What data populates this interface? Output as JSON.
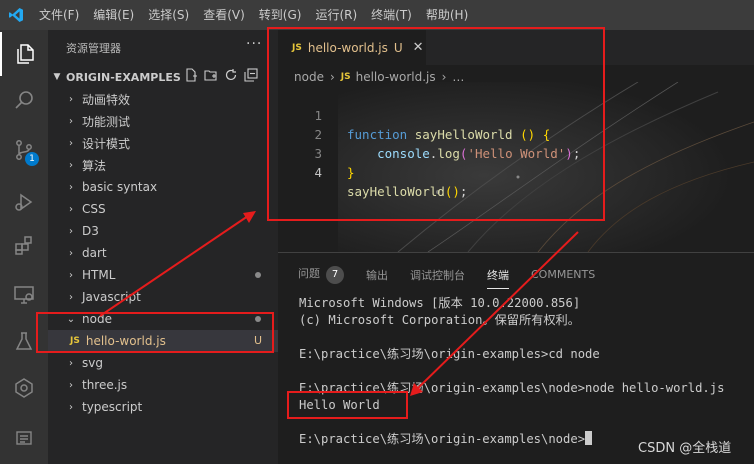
{
  "menu": [
    "文件(F)",
    "编辑(E)",
    "选择(S)",
    "查看(V)",
    "转到(G)",
    "运行(R)",
    "终端(T)",
    "帮助(H)"
  ],
  "activity_badge": "1",
  "sidebar": {
    "title": "资源管理器",
    "more": "···",
    "section": "ORIGIN-EXAMPLES",
    "items": [
      {
        "label": "动画特效",
        "type": "folder"
      },
      {
        "label": "功能测试",
        "type": "folder"
      },
      {
        "label": "设计模式",
        "type": "folder"
      },
      {
        "label": "算法",
        "type": "folder"
      },
      {
        "label": "basic syntax",
        "type": "folder"
      },
      {
        "label": "CSS",
        "type": "folder"
      },
      {
        "label": "D3",
        "type": "folder"
      },
      {
        "label": "dart",
        "type": "folder"
      },
      {
        "label": "HTML",
        "type": "folder"
      },
      {
        "label": "Javascript",
        "type": "folder"
      },
      {
        "label": "node",
        "type": "folder-open"
      },
      {
        "label": "hello-world.js",
        "type": "file",
        "icon": "JS",
        "status": "U"
      },
      {
        "label": "svg",
        "type": "folder"
      },
      {
        "label": "three.js",
        "type": "folder"
      },
      {
        "label": "typescript",
        "type": "folder"
      }
    ]
  },
  "editor": {
    "tab": {
      "icon": "JS",
      "name": "hello-world.js",
      "status": "U",
      "close": "✕"
    },
    "breadcrumb": {
      "folder": "node",
      "sep": "›",
      "file_icon": "JS",
      "file": "hello-world.js",
      "more": "…"
    },
    "lines": [
      {
        "num": "1",
        "text": "function sayHelloWorld () {"
      },
      {
        "num": "2",
        "text": "    console.log('Hello World');"
      },
      {
        "num": "3",
        "text": "}"
      },
      {
        "num": "4",
        "text": "sayHelloWorld();"
      }
    ]
  },
  "panel": {
    "tabs": [
      {
        "label": "问题",
        "count": "7"
      },
      {
        "label": "输出"
      },
      {
        "label": "调试控制台"
      },
      {
        "label": "终端"
      },
      {
        "label": "COMMENTS"
      }
    ],
    "terminal": [
      "Microsoft Windows [版本 10.0.22000.856]",
      "(c) Microsoft Corporation。保留所有权利。",
      "",
      "E:\\practice\\练习场\\origin-examples>cd node",
      "",
      "E:\\practice\\练习场\\origin-examples\\node>node hello-world.js",
      "Hello World",
      "",
      "E:\\practice\\练习场\\origin-examples\\node>"
    ]
  },
  "watermark": "CSDN @全栈道",
  "colors": {
    "accent": "#007acc",
    "annotation": "#e51c1c",
    "js_icon": "#e8c73a",
    "untracked": "#e2c08d"
  }
}
